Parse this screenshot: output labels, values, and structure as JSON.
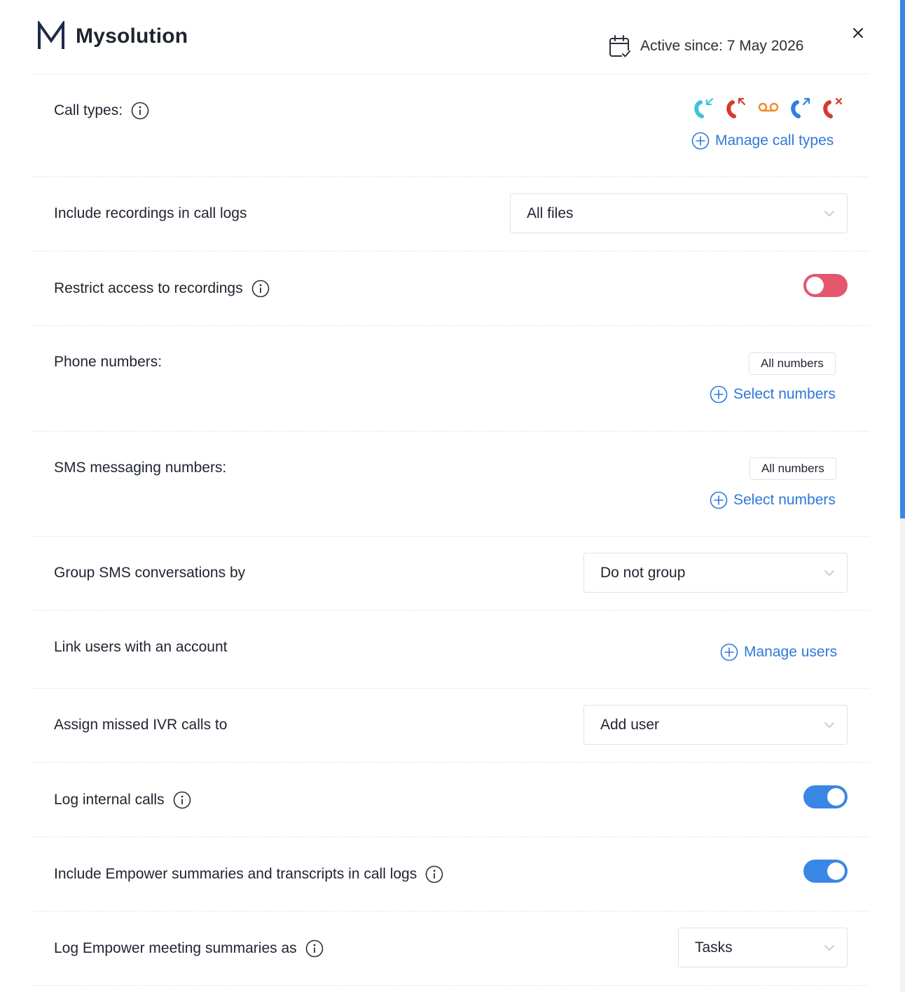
{
  "header": {
    "app_name": "Mysolution",
    "active_since": "Active since: 7 May 2026"
  },
  "call_types": {
    "label": "Call types:",
    "icons": [
      "incoming-call-icon",
      "missed-call-icon",
      "voicemail-icon",
      "outgoing-call-icon",
      "rejected-call-icon"
    ],
    "manage_label": "Manage call types"
  },
  "recordings": {
    "label": "Include recordings in call logs",
    "value": "All files"
  },
  "restrict_access": {
    "label": "Restrict access to recordings",
    "enabled": false
  },
  "phone_numbers": {
    "label": "Phone numbers:",
    "chip": "All numbers",
    "select_label": "Select numbers"
  },
  "sms_numbers": {
    "label": "SMS messaging numbers:",
    "chip": "All numbers",
    "select_label": "Select numbers"
  },
  "group_sms": {
    "label": "Group SMS conversations by",
    "value": "Do not group"
  },
  "link_users": {
    "label": "Link users with an account",
    "manage_label": "Manage users"
  },
  "assign_ivr": {
    "label": "Assign missed IVR calls to",
    "value": "Add user"
  },
  "log_internal": {
    "label": "Log internal calls",
    "enabled": true
  },
  "empower_summaries": {
    "label": "Include Empower summaries and transcripts in call logs",
    "enabled": true
  },
  "empower_meetings": {
    "label": "Log Empower meeting summaries as",
    "value": "Tasks"
  },
  "colors": {
    "accent": "#3a86e5",
    "link": "#2f78d8",
    "toggle_off": "#e5566f",
    "incoming": "#3fc4d6",
    "missed": "#d63a2f",
    "voicemail": "#f08a24",
    "outgoing": "#2f7fe6"
  }
}
